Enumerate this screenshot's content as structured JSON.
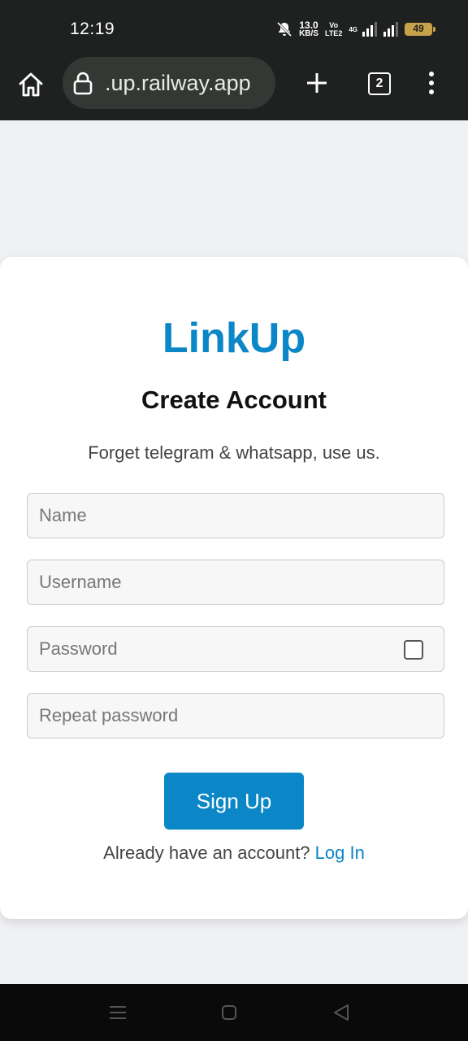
{
  "status_bar": {
    "time": "12:19",
    "net_speed_value": "13.0",
    "net_speed_unit": "KB/S",
    "volte_top": "Vo",
    "volte_bottom": "LTE2",
    "network_type": "4G",
    "battery": "49"
  },
  "browser": {
    "url": ".up.railway.app",
    "tab_count": "2"
  },
  "signup_form": {
    "brand": "LinkUp",
    "heading": "Create Account",
    "tagline": "Forget telegram & whatsapp, use us.",
    "name_placeholder": "Name",
    "username_placeholder": "Username",
    "password_placeholder": "Password",
    "repeat_password_placeholder": "Repeat password",
    "submit_label": "Sign Up",
    "login_prompt": "Already have an account?",
    "login_link": "Log In"
  },
  "colors": {
    "accent": "#0b86c6",
    "chrome": "#1f2120",
    "page_background": "#f0f1f3"
  }
}
